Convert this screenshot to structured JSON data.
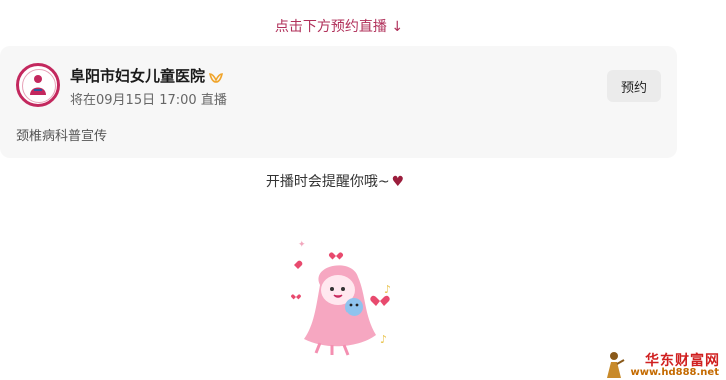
{
  "top_hint": "点击下方预约直播 ↓",
  "card": {
    "name": "阜阳市妇女儿童医院",
    "schedule": "将在09月15日 17:00 直播",
    "description": "颈椎病科普宣传",
    "reserve_label": "预约",
    "verified_icon": "verified-badge-icon",
    "logo_icon": "hospital-logo"
  },
  "remind": {
    "text": "开播时会提醒你哦~",
    "heart_icon": "heart-icon"
  },
  "watermark": {
    "logo_text": "华东财富网",
    "url": "www.hd888.net"
  },
  "colors": {
    "accent": "#b0305a",
    "card_bg": "#f7f7f7",
    "button_bg": "#ebebeb",
    "heart": "#9b1d3c"
  }
}
